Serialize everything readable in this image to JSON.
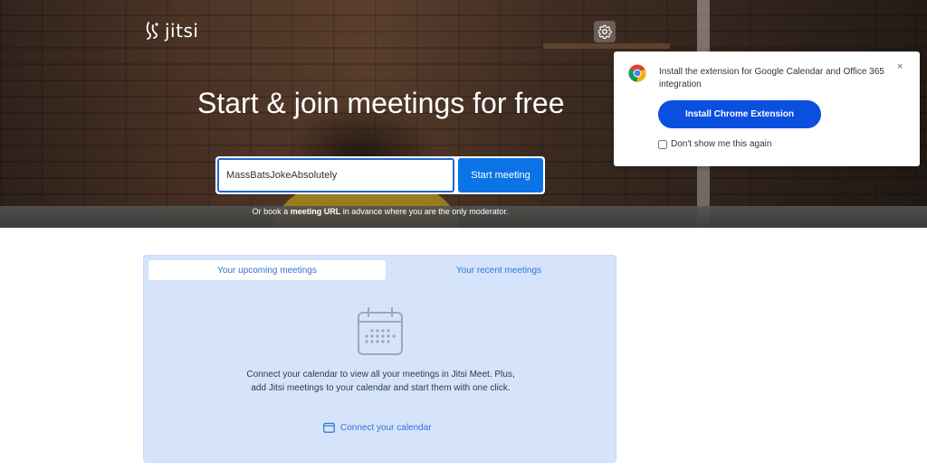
{
  "header": {
    "logo_text": "jitsi"
  },
  "hero": {
    "title": "Start & join meetings for free",
    "room_input_value": "MassBatsJokeAbsolutely",
    "start_button": "Start meeting",
    "note_prefix": "Or book a ",
    "note_bold": "meeting URL",
    "note_suffix": " in advance where you are the only moderator."
  },
  "extension_popup": {
    "message": "Install the extension for Google Calendar and Office 365 integration",
    "install_button": "Install Chrome Extension",
    "dont_show_label": "Don't show me this again",
    "close_symbol": "×"
  },
  "meetings_panel": {
    "tabs": [
      {
        "label": "Your upcoming meetings",
        "active": true
      },
      {
        "label": "Your recent meetings",
        "active": false
      }
    ],
    "empty_line_1": "Connect your calendar to view all your meetings in Jitsi Meet. Plus,",
    "empty_line_2": "add Jitsi meetings to your calendar and start them with one click.",
    "connect_link": "Connect your calendar"
  },
  "colors": {
    "primary_blue": "#0a74e6",
    "extension_blue": "#0a4fe0",
    "link_blue": "#2f74d3",
    "panel_bg": "#d5e4fb"
  },
  "icons": {
    "settings": "gear-icon",
    "chrome": "chrome-icon",
    "calendar": "calendar-icon",
    "close": "close-icon"
  }
}
